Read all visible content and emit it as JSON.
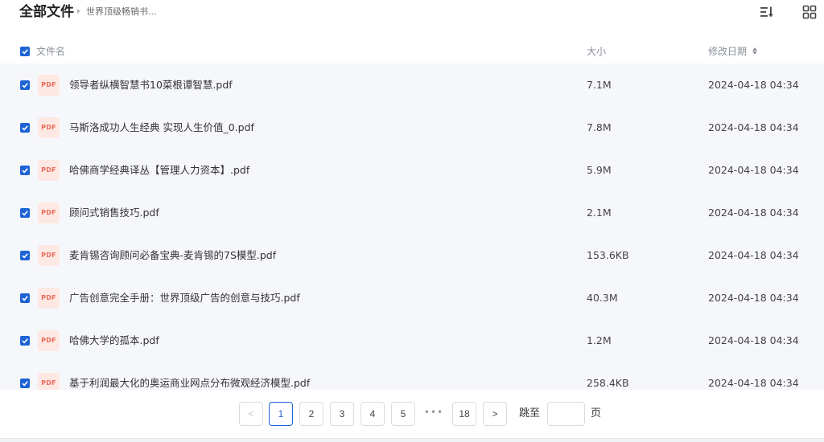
{
  "header": {
    "title": "全部文件",
    "breadcrumb": "世界顶级畅销书..."
  },
  "table": {
    "col_name": "文件名",
    "col_size": "大小",
    "col_date": "修改日期",
    "file_type_badge": "PDF",
    "rows": [
      {
        "name": "领导者纵横智慧书10菜根谭智慧.pdf",
        "size": "7.1M",
        "date": "2024-04-18 04:34"
      },
      {
        "name": "马斯洛成功人生经典 实现人生价值_0.pdf",
        "size": "7.8M",
        "date": "2024-04-18 04:34"
      },
      {
        "name": "哈佛商学经典译丛【管理人力资本】.pdf",
        "size": "5.9M",
        "date": "2024-04-18 04:34"
      },
      {
        "name": "顾问式销售技巧.pdf",
        "size": "2.1M",
        "date": "2024-04-18 04:34"
      },
      {
        "name": "麦肯锡咨询顾问必备宝典-麦肯锡的7S模型.pdf",
        "size": "153.6KB",
        "date": "2024-04-18 04:34"
      },
      {
        "name": "广告创意完全手册：世界顶级广告的创意与技巧.pdf",
        "size": "40.3M",
        "date": "2024-04-18 04:34"
      },
      {
        "name": "哈佛大学的孤本.pdf",
        "size": "1.2M",
        "date": "2024-04-18 04:34"
      },
      {
        "name": "基于利润最大化的奥运商业网点分布微观经济模型.pdf",
        "size": "258.4KB",
        "date": "2024-04-18 04:34"
      }
    ]
  },
  "pagination": {
    "prev": "<",
    "next": ">",
    "pages": [
      "1",
      "2",
      "3",
      "4",
      "5"
    ],
    "ellipsis": "•••",
    "last": "18",
    "current": "1",
    "jump_label": "跳至",
    "jump_value": "",
    "jump_unit": "页"
  },
  "icons": {
    "sort": "sort-list-icon",
    "view": "grid-view-icon",
    "checkbox": "checked-checkbox-icon"
  },
  "colors": {
    "accent": "#1e63d6",
    "pdf_badge_bg": "#fde8e4",
    "pdf_badge_text": "#ec6c5a",
    "list_bg": "#f6f7fb"
  }
}
